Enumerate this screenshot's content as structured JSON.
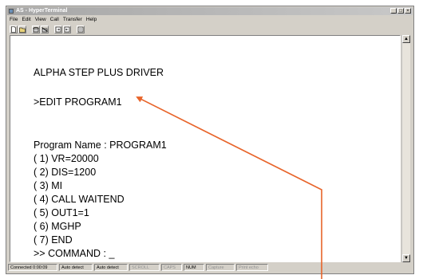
{
  "window": {
    "title": "AS - HyperTerminal"
  },
  "menu": [
    "File",
    "Edit",
    "View",
    "Call",
    "Transfer",
    "Help"
  ],
  "toolbar": {
    "icons": [
      "new-icon",
      "open-icon",
      "phone-icon",
      "hangup-icon",
      "send-icon",
      "receive-icon",
      "properties-icon"
    ]
  },
  "terminal": {
    "header": "ALPHA STEP PLUS DRIVER",
    "command": ">EDIT PROGRAM1",
    "program_name": "Program Name : PROGRAM1",
    "lines": [
      "( 1) VR=20000",
      "( 2) DIS=1200",
      "( 3) MI",
      "( 4) CALL WAITEND",
      "( 5) OUT1=1",
      "( 6) MGHP",
      "( 7) END"
    ],
    "prompt": ">> COMMAND : _"
  },
  "status": {
    "connected": "Connected 0:00:09",
    "detect1": "Auto detect",
    "detect2": "Auto detect",
    "scroll": "SCROLL",
    "caps": "CAPS",
    "num": "NUM",
    "capture": "Capture",
    "print_echo": "Print echo"
  },
  "colors": {
    "annotation": "#e8642a"
  }
}
